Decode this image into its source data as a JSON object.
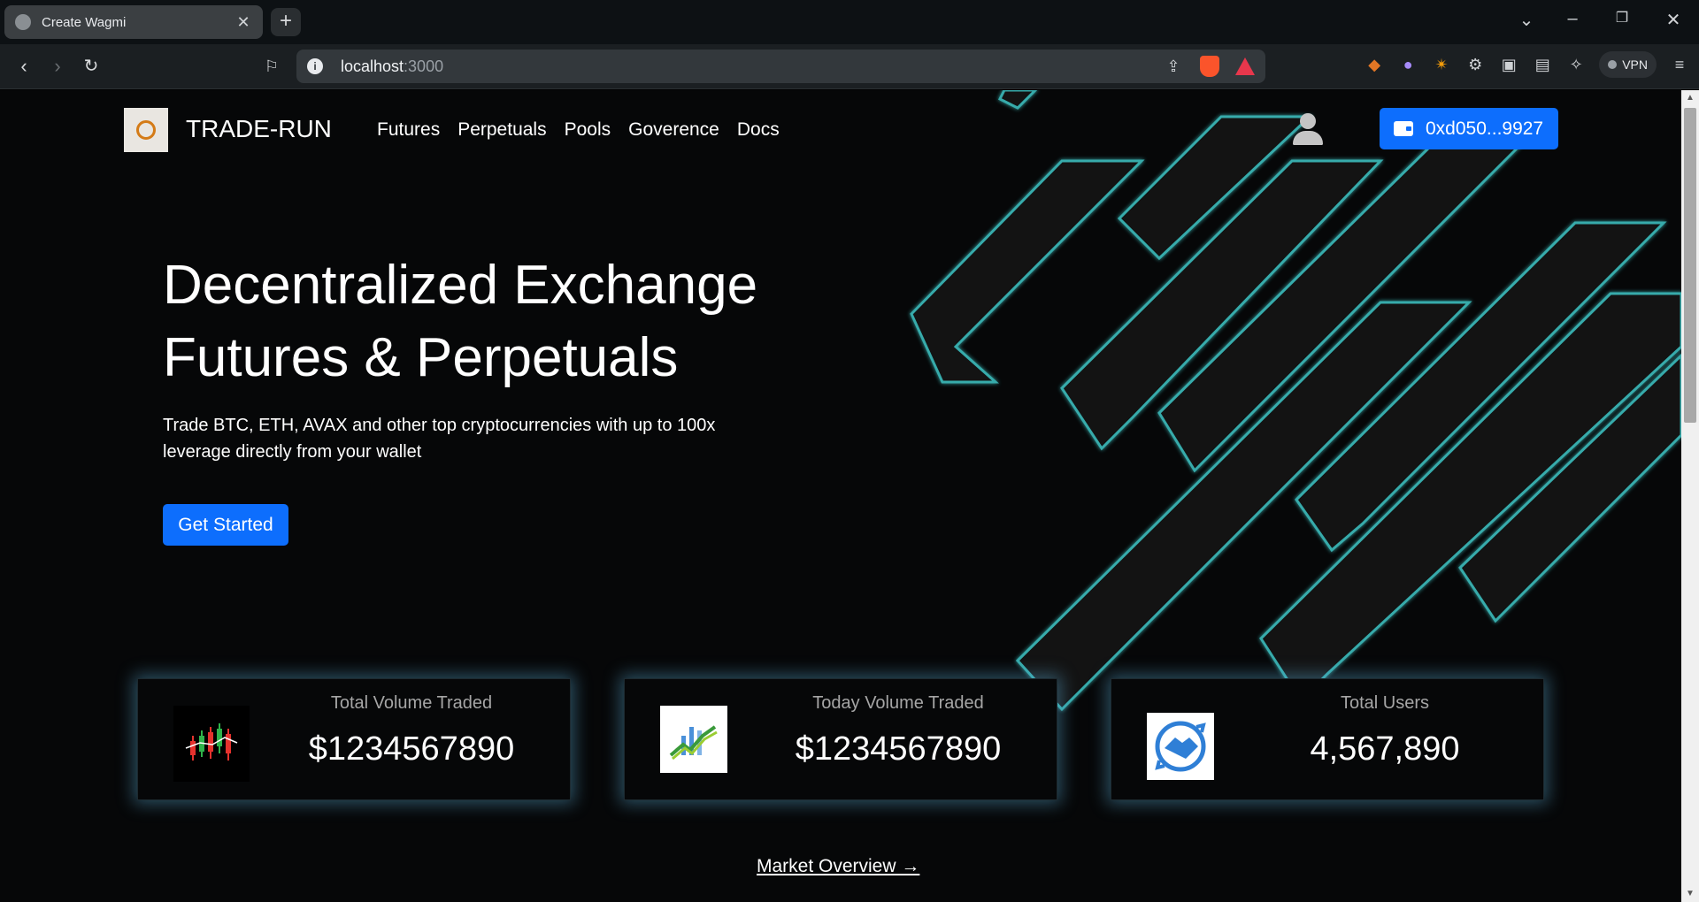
{
  "browser": {
    "tab_title": "Create Wagmi",
    "new_tab": "+",
    "url_host": "localhost",
    "url_port": ":3000",
    "vpn_label": "VPN"
  },
  "nav": {
    "brand": "TRADE-RUN",
    "links": [
      "Futures",
      "Perpetuals",
      "Pools",
      "Goverence",
      "Docs"
    ],
    "wallet_address": "0xd050...9927"
  },
  "hero": {
    "title_line1": "Decentralized Exchange",
    "title_line2": "Futures & Perpetuals",
    "subtitle": "Trade BTC, ETH, AVAX and other top cryptocurrencies with up to 100x leverage directly from your wallet",
    "cta_label": "Get Started"
  },
  "stats": [
    {
      "label": "Total Volume Traded",
      "value": "$1234567890",
      "icon": "candlestick-chart-icon"
    },
    {
      "label": "Today Volume Traded",
      "value": "$1234567890",
      "icon": "growth-chart-icon"
    },
    {
      "label": "Total Users",
      "value": "4,567,890",
      "icon": "handshake-icon"
    }
  ],
  "market_link": "Market Overview →",
  "colors": {
    "accent": "#0d6efd",
    "background": "#060708",
    "neon": "#3fc8c8",
    "card_glow": "#5aaad2"
  }
}
